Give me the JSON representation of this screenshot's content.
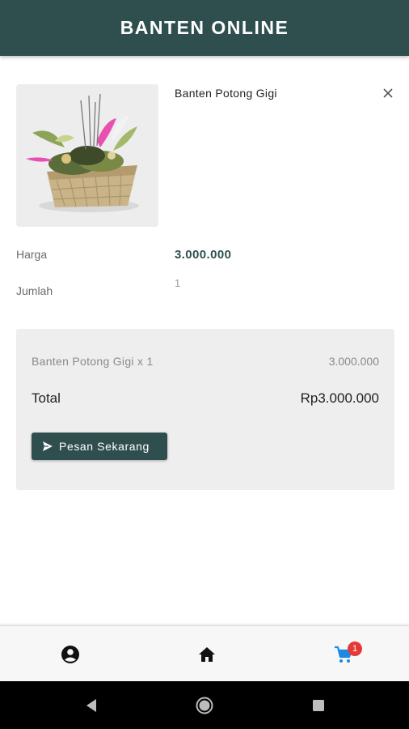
{
  "app_bar": {
    "title": "BANTEN ONLINE"
  },
  "cart_item": {
    "image_icon": "banten-basket-image",
    "name": "Banten Potong Gigi",
    "remove_icon": "close-icon",
    "price_label": "Harga",
    "price_value": "3.000.000",
    "qty_label": "Jumlah",
    "qty_value": "1"
  },
  "summary": {
    "item_line": "Banten Potong Gigi x 1",
    "item_price": "3.000.000",
    "total_label": "Total",
    "total_value": "Rp3.000.000",
    "order_button_label": "Pesan Sekarang",
    "order_button_icon": "send-icon"
  },
  "bottom_nav": {
    "items": [
      {
        "icon": "account-circle-icon",
        "active": false
      },
      {
        "icon": "home-icon",
        "active": false
      },
      {
        "icon": "cart-icon",
        "active": true
      }
    ],
    "cart_badge": "1"
  },
  "colors": {
    "primary": "#2f4f4f",
    "active_nav": "#1e88e5",
    "badge": "#e53935"
  }
}
